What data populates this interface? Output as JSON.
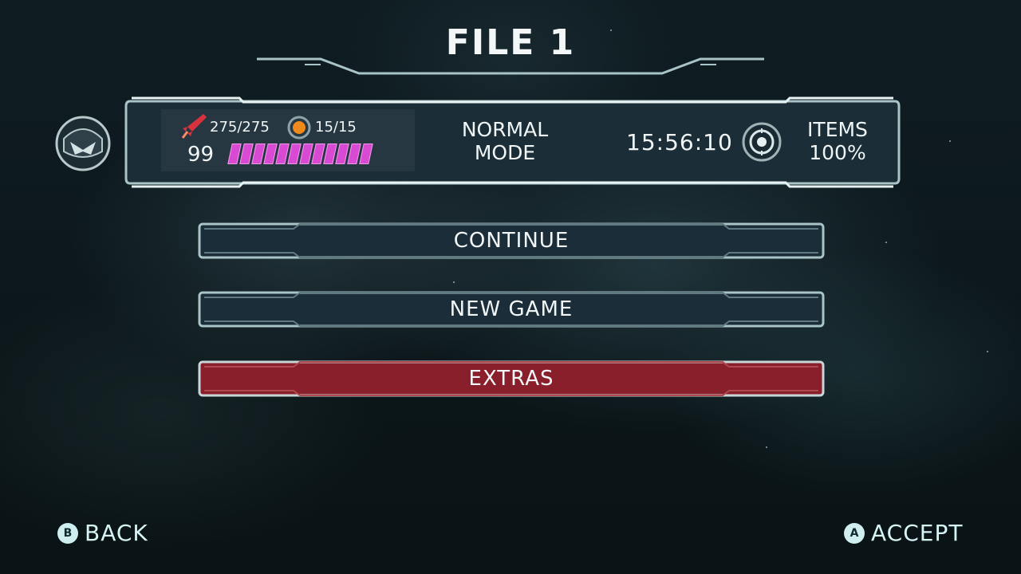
{
  "screen": {
    "title": "FILE 1"
  },
  "save_file": {
    "missiles": "275/275",
    "power_bombs": "15/15",
    "energy": "99",
    "energy_tanks_full": 12,
    "difficulty": "NORMAL MODE",
    "play_time": "15:56:10",
    "items_label": "ITEMS",
    "items_percent": "100%"
  },
  "menu": {
    "continue_label": "CONTINUE",
    "new_game_label": "NEW GAME",
    "extras_label": "EXTRAS",
    "selected": "extras"
  },
  "footer": {
    "back_glyph": "B",
    "back_label": "BACK",
    "accept_glyph": "A",
    "accept_label": "ACCEPT"
  },
  "colors": {
    "accent_frame": "#a9c4c6",
    "button_fill": "#1a2d38",
    "selected_fill": "#8a1f2c",
    "energy_tank": "#d94ad3",
    "missile_icon": "#d8323f",
    "power_bomb_icon": "#f08a1c"
  },
  "icons": {
    "emblem": "samus-helmet-emblem-icon",
    "missile": "missile-icon",
    "power_bomb": "power-bomb-icon",
    "play_time": "play-time-orb-icon"
  }
}
